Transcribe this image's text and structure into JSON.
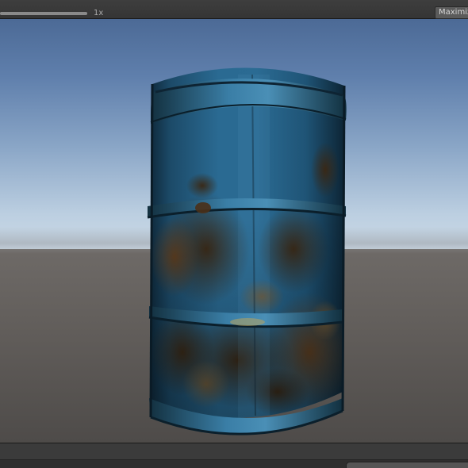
{
  "toolbar": {
    "scale_label": "1x",
    "scale_value": 1,
    "maximize_label": "Maximize On Play"
  },
  "scene": {
    "object": "rusty-blue-barrel",
    "colors": {
      "sky_top": "#4c6a96",
      "sky_horizon": "#cbd9e6",
      "ground": "#6e6a67",
      "barrel_blue": "#1f5a80",
      "rust": "#5a3a1e"
    }
  }
}
